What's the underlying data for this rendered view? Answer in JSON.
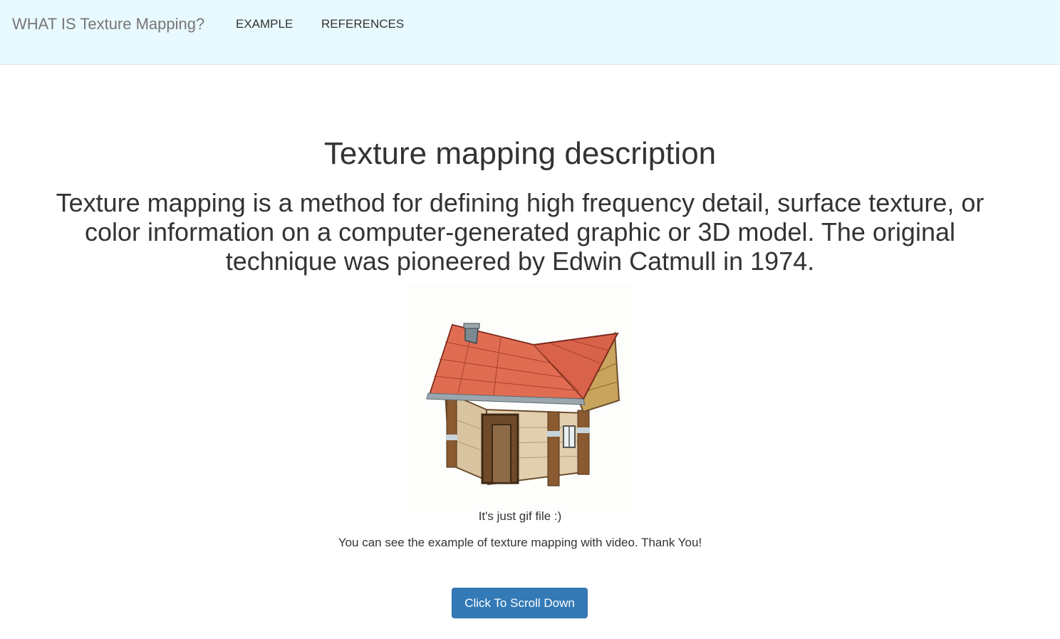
{
  "navbar": {
    "brand": "WHAT IS Texture Mapping?",
    "links": [
      {
        "label": "EXAMPLE"
      },
      {
        "label": "REFERENCES"
      }
    ],
    "background_color": "#e8f9ff"
  },
  "main": {
    "title": "Texture mapping description",
    "description": "Texture mapping is a method for defining high frequency detail, surface texture, or color information on a computer-generated graphic or 3D model. The original technique was pioneered by Edwin Catmull in 1974.",
    "image": {
      "subject": "textured 3D house model with red tile roof"
    },
    "caption": "It's just gif file :)",
    "note": "You can see the example of texture mapping with video. Thank You!",
    "button": {
      "label": "Click To Scroll Down",
      "color": "#337ab7"
    }
  }
}
